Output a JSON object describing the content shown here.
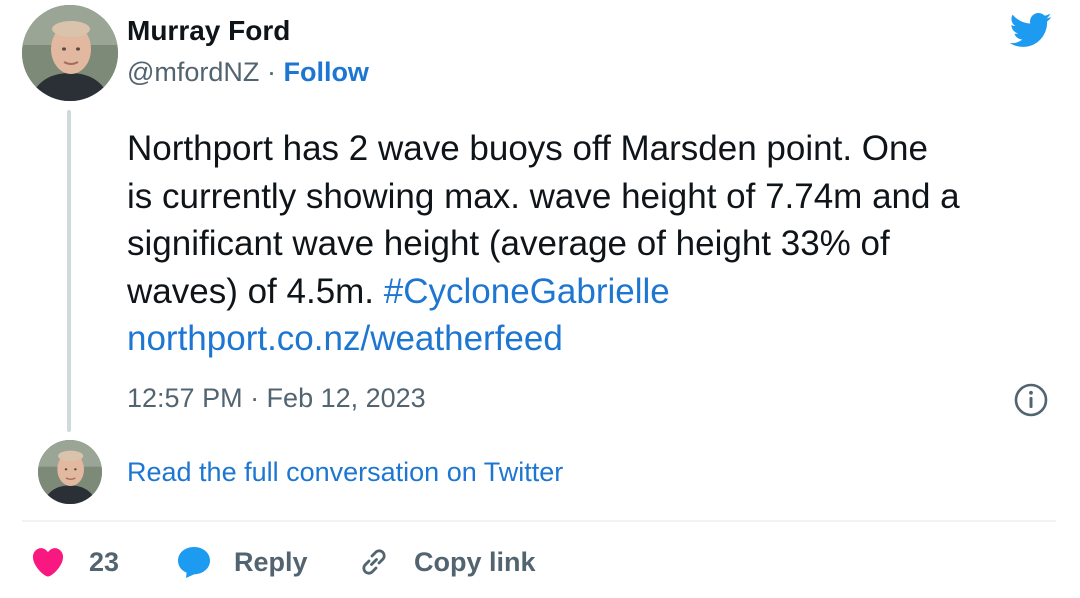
{
  "author": {
    "display_name": "Murray Ford",
    "handle": "@mfordNZ",
    "separator": "·",
    "follow_label": "Follow"
  },
  "tweet": {
    "lines": [
      "Northport has 2 wave buoys off Marsden point. One",
      "is currently showing max. wave height of 7.74m and a",
      "significant wave height (average of height 33% of",
      "waves) of 4.5m."
    ],
    "hashtag": "#CycloneGabrielle",
    "link": "northport.co.nz/weatherfeed",
    "timestamp": "12:57 PM · Feb 12, 2023"
  },
  "conversation_link": "Read the full conversation on Twitter",
  "actions": {
    "likes_count": "23",
    "reply_label": "Reply",
    "copy_link_label": "Copy link"
  },
  "colors": {
    "link_blue": "#1d76d2",
    "twitter_blue": "#1d9bf0",
    "like_pink": "#f91880",
    "muted_gray": "#536471"
  },
  "icons": {
    "brand": "twitter-bird-icon",
    "info": "info-icon",
    "like": "heart-icon",
    "reply": "speech-bubble-icon",
    "copy": "link-icon"
  }
}
